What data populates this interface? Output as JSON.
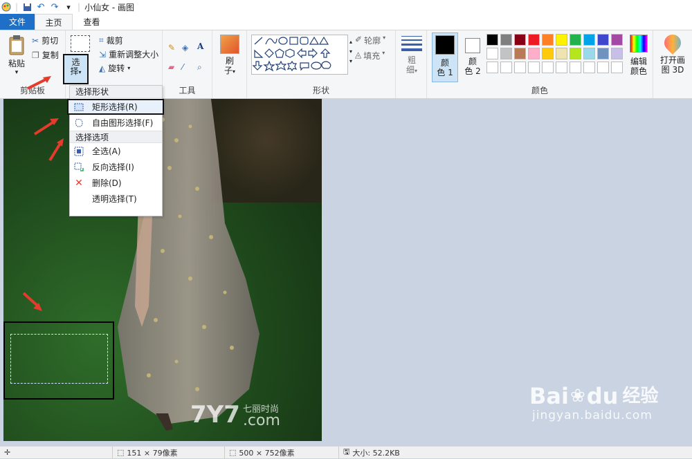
{
  "window": {
    "title": "小仙女 - 画图",
    "quick_access_more": "▾"
  },
  "tabs": [
    {
      "label": "文件"
    },
    {
      "label": "主页"
    },
    {
      "label": "查看"
    }
  ],
  "ribbon": {
    "clipboard": {
      "paste": "粘贴",
      "cut": "剪切",
      "copy": "复制",
      "label": "剪贴板"
    },
    "image": {
      "select": "选择",
      "select_line1": "选",
      "select_line2": "择",
      "crop": "裁剪",
      "resize": "重新调整大小",
      "rotate": "旋转"
    },
    "tools": {
      "label": "工具"
    },
    "brush": {
      "line1": "刷",
      "line2": "子"
    },
    "shapes": {
      "outline": "轮廓",
      "fill": "填充",
      "label": "形状"
    },
    "size": {
      "line1": "粗",
      "line2": "细"
    },
    "colors": {
      "color1_line1": "颜",
      "color1_line2": "色 1",
      "color2_line1": "颜",
      "color2_line2": "色 2",
      "edit_line1": "编辑",
      "edit_line2": "颜色",
      "label": "颜色",
      "palette_row1": [
        "#000000",
        "#7f7f7f",
        "#880015",
        "#ed1c24",
        "#ff7f27",
        "#fff200",
        "#22b14c",
        "#00a2e8",
        "#3f48cc",
        "#a349a4"
      ],
      "palette_row2": [
        "#ffffff",
        "#c3c3c3",
        "#b97a57",
        "#ffaec9",
        "#ffc90e",
        "#efe4b0",
        "#b5e61d",
        "#99d9ea",
        "#7092be",
        "#c8bfe7"
      ]
    },
    "paint3d": {
      "line1": "打开画",
      "line2": "图 3D"
    }
  },
  "menu": {
    "section1": "选择形状",
    "rect_select": "矩形选择(R)",
    "free_select": "自由图形选择(F)",
    "section2": "选择选项",
    "select_all": "全选(A)",
    "invert": "反向选择(I)",
    "delete": "删除(D)",
    "transparent": "透明选择(T)"
  },
  "watermark": {
    "site_logo": "7Y7",
    "site_cn": "七丽时尚",
    "site_domain": ".com",
    "baidu_logo": "Bai",
    "baidu_du": "du",
    "baidu_cn": "经验",
    "baidu_url": "jingyan.baidu.com"
  },
  "status": {
    "selection": "151 × 79像素",
    "image_size": "500 × 752像素",
    "file_size": "大小: 52.2KB"
  },
  "colors": {
    "accent": "#1e6fc7",
    "annotation": "#e53b2c"
  }
}
